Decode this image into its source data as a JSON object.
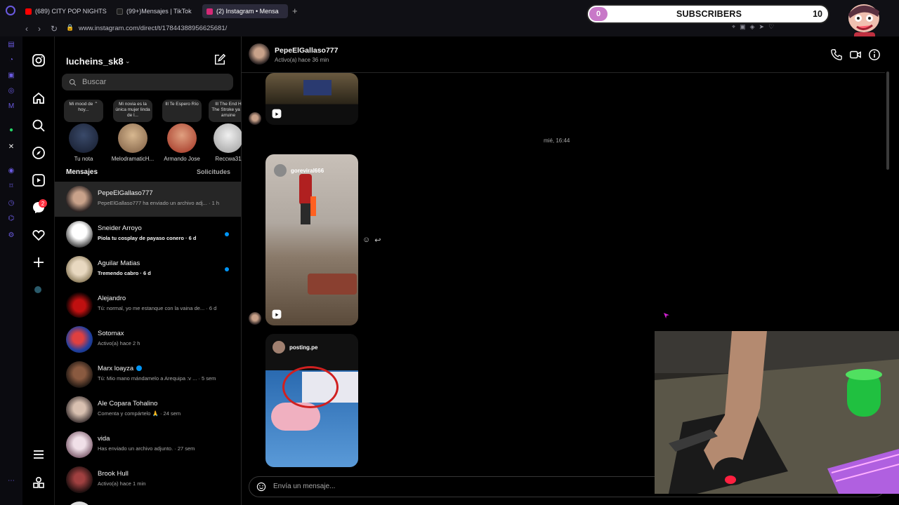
{
  "browser": {
    "tabs": [
      {
        "label": "(689) CITY POP NIGHTS –",
        "fav": "#ff0000"
      },
      {
        "label": "(99+)Mensajes | TikTok",
        "fav": "#202020"
      },
      {
        "label": "(2) Instagram • Mensa",
        "fav": "#d62976",
        "active": true
      }
    ],
    "url": "www.instagram.com/direct/t/17844388956625681/"
  },
  "overlay": {
    "left_count": "0",
    "title": "SUBSCRIBERS",
    "right_count": "10"
  },
  "dm": {
    "username": "lucheins_sk8",
    "search_placeholder": "Buscar",
    "notes": [
      {
        "bubble": "Mi mood de ⌃ hoy...",
        "name": "Tu nota"
      },
      {
        "bubble": "Mi novia es la única mujer linda de l...",
        "name": "MelodramaticH..."
      },
      {
        "bubble": "Ill Te Espero Río",
        "name": "Armando Jose"
      },
      {
        "bubble": "Ill The End H The Stroke ya la arruine",
        "name": "Reccwa31"
      }
    ],
    "section_title": "Mensajes",
    "requests_label": "Solicitudes",
    "conversations": [
      {
        "name": "PepeElGallaso777",
        "sub": "PepeElGallaso777 ha enviado un archivo adj... · 1 h",
        "active": true,
        "unread": false
      },
      {
        "name": "Sneider Arroyo",
        "sub": "Piola tu cosplay de payaso conero · 6 d",
        "active": false,
        "unread": true
      },
      {
        "name": "Aguilar Matias",
        "sub": "Tremendo cabro · 6 d",
        "active": false,
        "unread": true
      },
      {
        "name": "Alejandro",
        "sub": "Tú: normal, yo me estanque con la vaina de... · 6 d",
        "active": false,
        "unread": false
      },
      {
        "name": "Sotomax",
        "sub": "Activo(a) hace 2 h",
        "active": false,
        "unread": false
      },
      {
        "name": "Marx loayza",
        "sub": "Tú: Mio mano mándamelo a Arequipa :v ... · 5 sem",
        "active": false,
        "unread": false,
        "verified": true
      },
      {
        "name": "Ale Copara Tohalino",
        "sub": "Comenta y compártelo 🙏 · 24 sem",
        "active": false,
        "unread": false
      },
      {
        "name": "vida",
        "sub": "Has enviado un archivo adjunto. · 27 sem",
        "active": false,
        "unread": false
      },
      {
        "name": "Brook Hull",
        "sub": "Activo(a) hace 1 min",
        "active": false,
        "unread": false
      }
    ]
  },
  "chat": {
    "name": "PepeElGallaso777",
    "status": "Activo(a) hace 36 min",
    "timestamp": "mié, 16:44",
    "reel1_user": "goreviral666",
    "post_user": "posting.pe",
    "composer_placeholder": "Envía un mensaje..."
  },
  "colors": {
    "accent_blue": "#0095f6",
    "badge_red": "#ff3040",
    "overlay_pink": "#c878c8"
  }
}
